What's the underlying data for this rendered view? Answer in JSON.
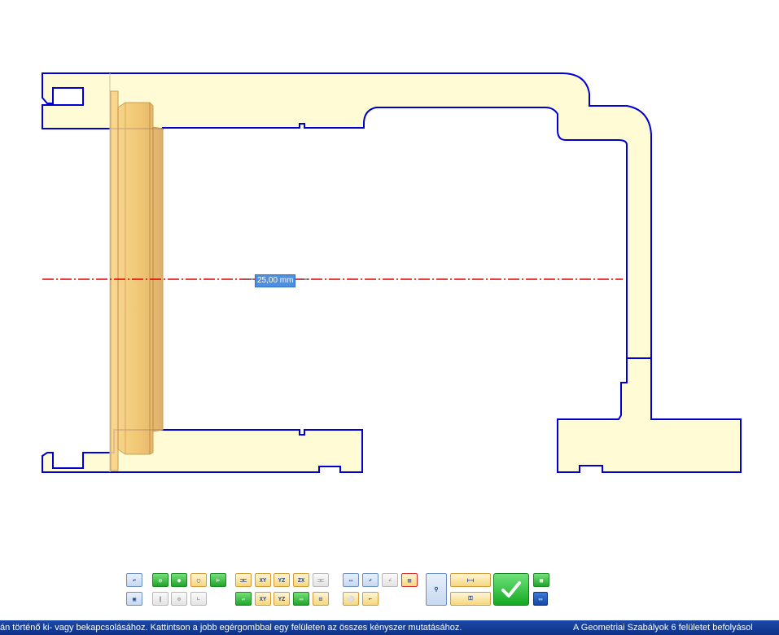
{
  "drawing": {
    "dimension_value": "25,00 mm",
    "colors": {
      "outline": "#0000d4",
      "fill": "#fffbd5",
      "ring_fill": "#f2c56e",
      "axis": "#e00000"
    }
  },
  "toolbar": {
    "buttons": [
      {
        "name": "undo-icon",
        "glyph": "↶",
        "style": "blue"
      },
      {
        "name": "save-icon",
        "glyph": "▣",
        "style": "blue"
      },
      {
        "name": "circle-constraint-icon",
        "glyph": "◎",
        "style": "green"
      },
      {
        "name": "point-constraint-icon",
        "glyph": "●",
        "style": "green"
      },
      {
        "name": "plane-constraint-icon",
        "glyph": "▢",
        "style": "default"
      },
      {
        "name": "insert-constraint-icon",
        "glyph": "⊢",
        "style": "green"
      },
      {
        "name": "parallel-icon",
        "glyph": "∥",
        "style": "gray"
      },
      {
        "name": "concentric-icon",
        "glyph": "⊚",
        "style": "gray"
      },
      {
        "name": "perpendicular-icon",
        "glyph": "∟",
        "style": "gray"
      },
      {
        "name": "symmetric-icon",
        "glyph": "⊐⊏",
        "style": "default"
      },
      {
        "name": "symmetric-xy-icon",
        "glyph": "XY",
        "style": "default"
      },
      {
        "name": "symmetric-yz-icon",
        "glyph": "YZ",
        "style": "default"
      },
      {
        "name": "symmetric-zx-icon",
        "glyph": "ZX",
        "style": "default"
      },
      {
        "name": "symmetric-off-icon",
        "glyph": "⊐⊏",
        "style": "gray"
      },
      {
        "name": "plane-align-icon",
        "glyph": "▱",
        "style": "green"
      },
      {
        "name": "plane-xy-icon",
        "glyph": "XY",
        "style": "default"
      },
      {
        "name": "plane-yz-icon",
        "glyph": "YZ",
        "style": "default"
      },
      {
        "name": "plane-green-icon",
        "glyph": "▭",
        "style": "green"
      },
      {
        "name": "plane-center-icon",
        "glyph": "⊡",
        "style": "default"
      },
      {
        "name": "rectangle-icon",
        "glyph": "▭",
        "style": "blue"
      },
      {
        "name": "rectangle-arrow-icon",
        "glyph": "⬈",
        "style": "blue"
      },
      {
        "name": "angle-icon",
        "glyph": "∠",
        "style": "gray"
      },
      {
        "name": "image-frame-icon",
        "glyph": "▨",
        "style": "red"
      },
      {
        "name": "equal-circles-icon",
        "glyph": "⚪",
        "style": "default"
      },
      {
        "name": "corner-icon",
        "glyph": "⌐",
        "style": "default"
      },
      {
        "name": "pin-icon",
        "glyph": "⚲",
        "style": "blue"
      },
      {
        "name": "distance-icon",
        "glyph": "⊢⊣",
        "style": "default"
      },
      {
        "name": "distance-lock-icon",
        "glyph": "⚿",
        "style": "default"
      },
      {
        "name": "grid-icon",
        "glyph": "▦",
        "style": "green"
      },
      {
        "name": "window-icon",
        "glyph": "▭",
        "style": "sqblue"
      }
    ],
    "ok_label": "✓"
  },
  "status": {
    "left": "án történő ki- vagy bekapcsolásához. Kattintson a jobb egérgombbal egy felületen az összes kényszer mutatásához.",
    "right": "A Geometriai Szabályok 6 felületet befolyásol"
  }
}
